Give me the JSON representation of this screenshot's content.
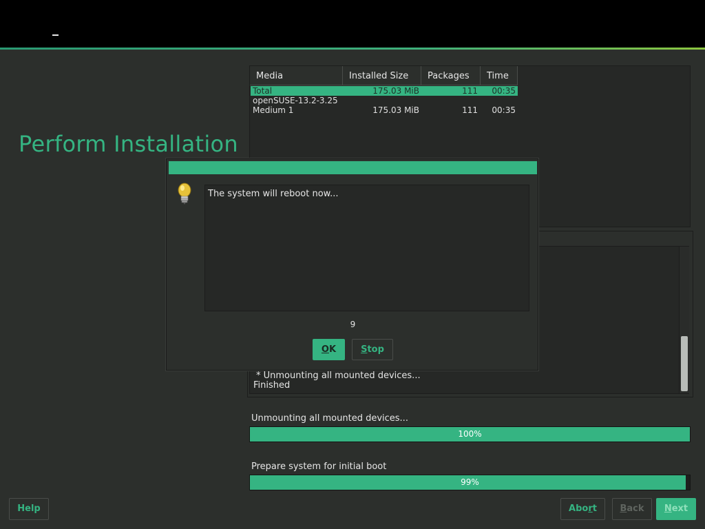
{
  "page": {
    "title": "Perform Installation"
  },
  "media_table": {
    "columns": [
      "Media",
      "Installed Size",
      "Packages",
      "Time"
    ],
    "rows": [
      {
        "media": "Total",
        "size": "175.03 MiB",
        "packages": "111",
        "time": "00:35",
        "selected": true
      },
      {
        "media": "openSUSE-13.2-3.25",
        "size": "",
        "packages": "",
        "time": "",
        "selected": false
      },
      {
        "media": "Medium 1",
        "size": "175.03 MiB",
        "packages": "111",
        "time": "00:35",
        "selected": false
      }
    ]
  },
  "log": {
    "lines": [
      "* Unmounting all mounted devices...",
      "Finished"
    ]
  },
  "progress": [
    {
      "label": "Unmounting all mounted devices...",
      "percent_text": "100%",
      "value": 100
    },
    {
      "label": "Prepare system for initial boot",
      "percent_text": "99%",
      "value": 99
    }
  ],
  "buttons": {
    "help": "Help",
    "abort_pre": "Abo",
    "abort_key": "r",
    "abort_post": "t",
    "back_key": "B",
    "back_post": "ack",
    "next_key": "N",
    "next_post": "ext"
  },
  "dialog": {
    "icon": "lightbulb-icon",
    "message": "The system will reboot now...",
    "countdown": "9",
    "ok_key": "O",
    "ok_post": "K",
    "stop_key": "S",
    "stop_post": "top"
  },
  "colors": {
    "accent": "#35b482",
    "background": "#2c2f2c",
    "topbar": "#000000"
  }
}
